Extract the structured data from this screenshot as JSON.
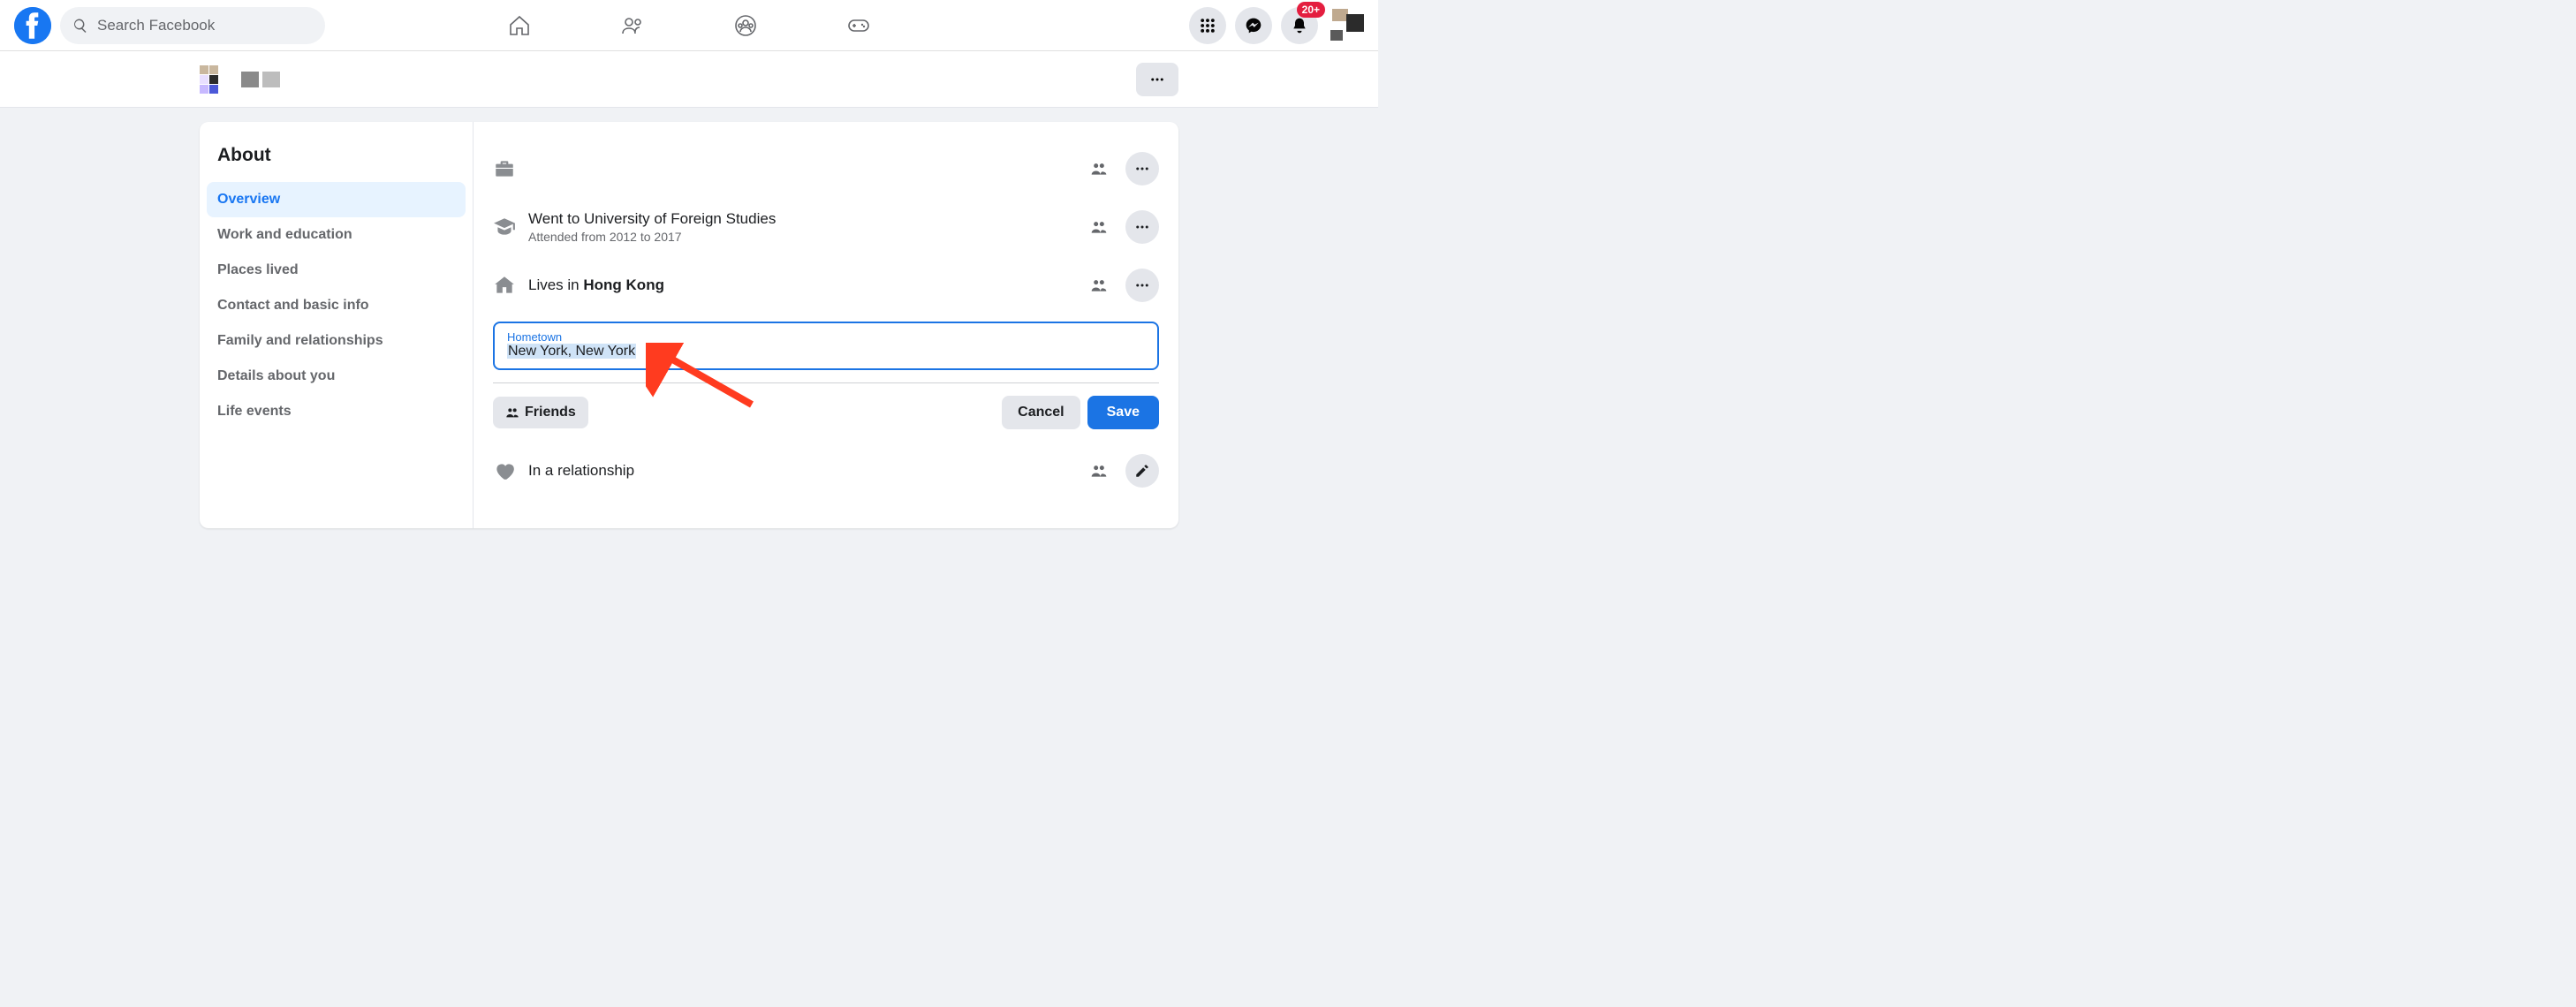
{
  "search": {
    "placeholder": "Search Facebook"
  },
  "notifications": {
    "badge": "20+"
  },
  "sidebar": {
    "title": "About",
    "tabs": [
      {
        "label": "Overview",
        "active": true
      },
      {
        "label": "Work and education",
        "active": false
      },
      {
        "label": "Places lived",
        "active": false
      },
      {
        "label": "Contact and basic info",
        "active": false
      },
      {
        "label": "Family and relationships",
        "active": false
      },
      {
        "label": "Details about you",
        "active": false
      },
      {
        "label": "Life events",
        "active": false
      }
    ]
  },
  "overview": {
    "education": {
      "prefix": "Went to ",
      "school": "University of Foreign Studies",
      "sub": "Attended from 2012 to 2017"
    },
    "current_city": {
      "prefix": "Lives in ",
      "city": "Hong Kong"
    },
    "hometown_field": {
      "label": "Hometown",
      "value": "New York, New York"
    },
    "audience_button": {
      "label": "Friends"
    },
    "buttons": {
      "cancel": "Cancel",
      "save": "Save"
    },
    "relationship": {
      "text": "In a relationship"
    }
  }
}
